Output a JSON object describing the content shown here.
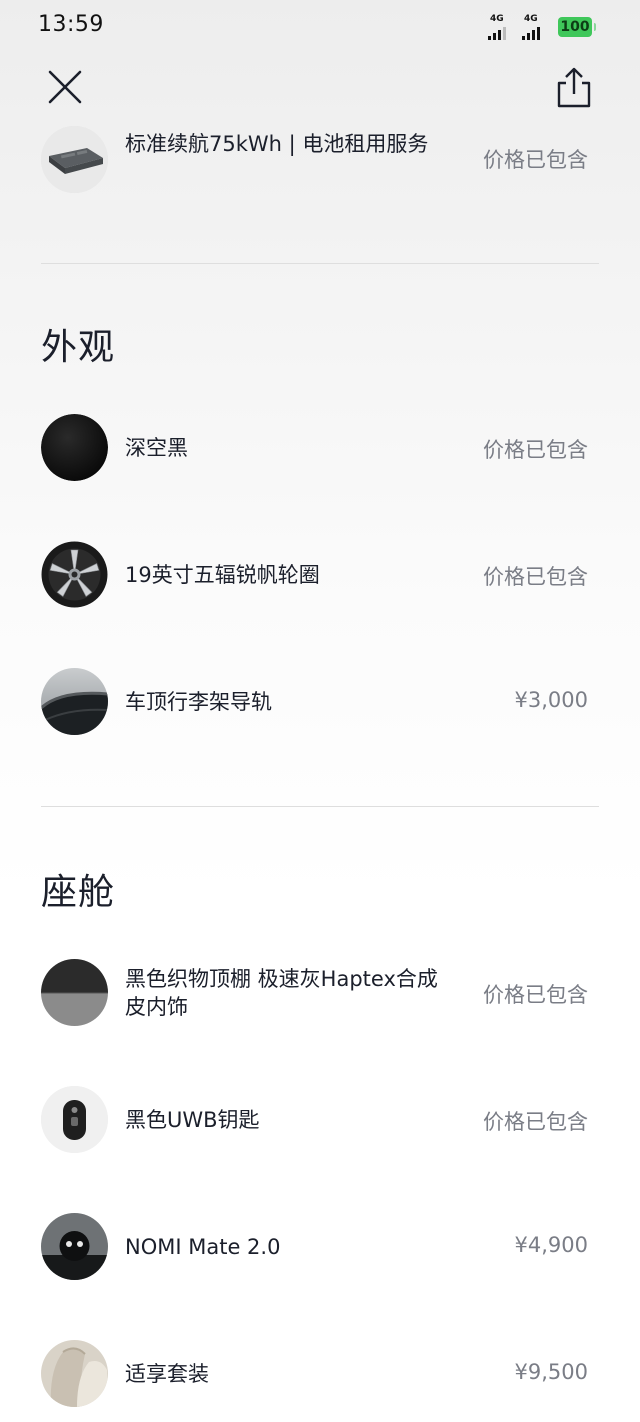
{
  "status_bar": {
    "time": "13:59",
    "network_1": "4G",
    "network_2": "4G",
    "battery": "100",
    "battery_color": "#3fc75a"
  },
  "header": {
    "close_icon": "close-icon",
    "share_icon": "share-icon"
  },
  "battery_item": {
    "name": "标准续航75kWh | 电池租用服务",
    "price": "价格已包含",
    "icon": "battery-pack-thumbnail"
  },
  "sections": {
    "exterior": {
      "title": "外观",
      "items": [
        {
          "name": "深空黑",
          "price": "价格已包含",
          "icon": "black-paint-swatch"
        },
        {
          "name": "19英寸五辐锐帆轮圈",
          "price": "价格已包含",
          "icon": "wheel-thumbnail"
        },
        {
          "name": "车顶行李架导轨",
          "price": "¥3,000",
          "icon": "roof-rail-thumbnail"
        }
      ]
    },
    "cabin": {
      "title": "座舱",
      "items": [
        {
          "name": "黑色织物顶棚 极速灰Haptex合成皮内饰",
          "price": "价格已包含",
          "icon": "interior-swatch"
        },
        {
          "name": "黑色UWB钥匙",
          "price": "价格已包含",
          "icon": "key-fob-thumbnail"
        },
        {
          "name": "NOMI Mate 2.0",
          "price": "¥4,900",
          "icon": "nomi-thumbnail"
        },
        {
          "name": "适享套装",
          "price": "¥9,500",
          "icon": "seat-package-thumbnail"
        }
      ]
    }
  }
}
